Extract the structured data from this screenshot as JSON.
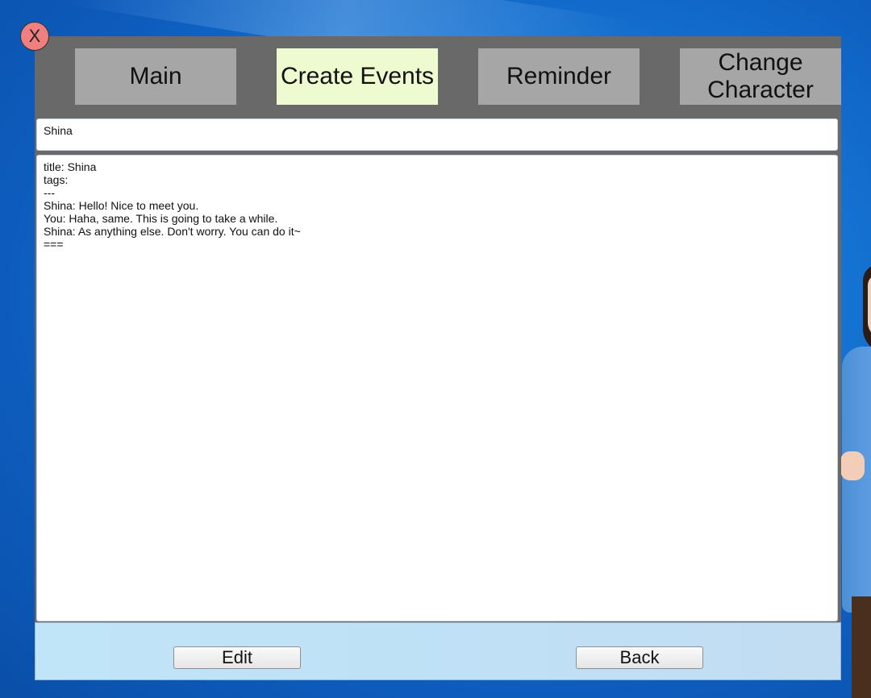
{
  "close_label": "X",
  "tabs": {
    "main": "Main",
    "create_events": "Create Events",
    "reminder": "Reminder",
    "change_character_line1": "Change",
    "change_character_line2": "Character"
  },
  "active_tab": "Create Events",
  "title_field": {
    "value": "Shina"
  },
  "content_field": {
    "value": "title: Shina\ntags:\n---\nShina: Hello! Nice to meet you.\nYou: Haha, same. This is going to take a while.\nShina: As anything else. Don't worry. You can do it~\n==="
  },
  "buttons": {
    "edit": "Edit",
    "back": "Back"
  },
  "colors": {
    "window": "#696969",
    "tab": "#a6a6a6",
    "tab_active": "#eefad0",
    "close": "#f08080",
    "footer": "#c0e4f8",
    "desktop": "#1677d6"
  }
}
